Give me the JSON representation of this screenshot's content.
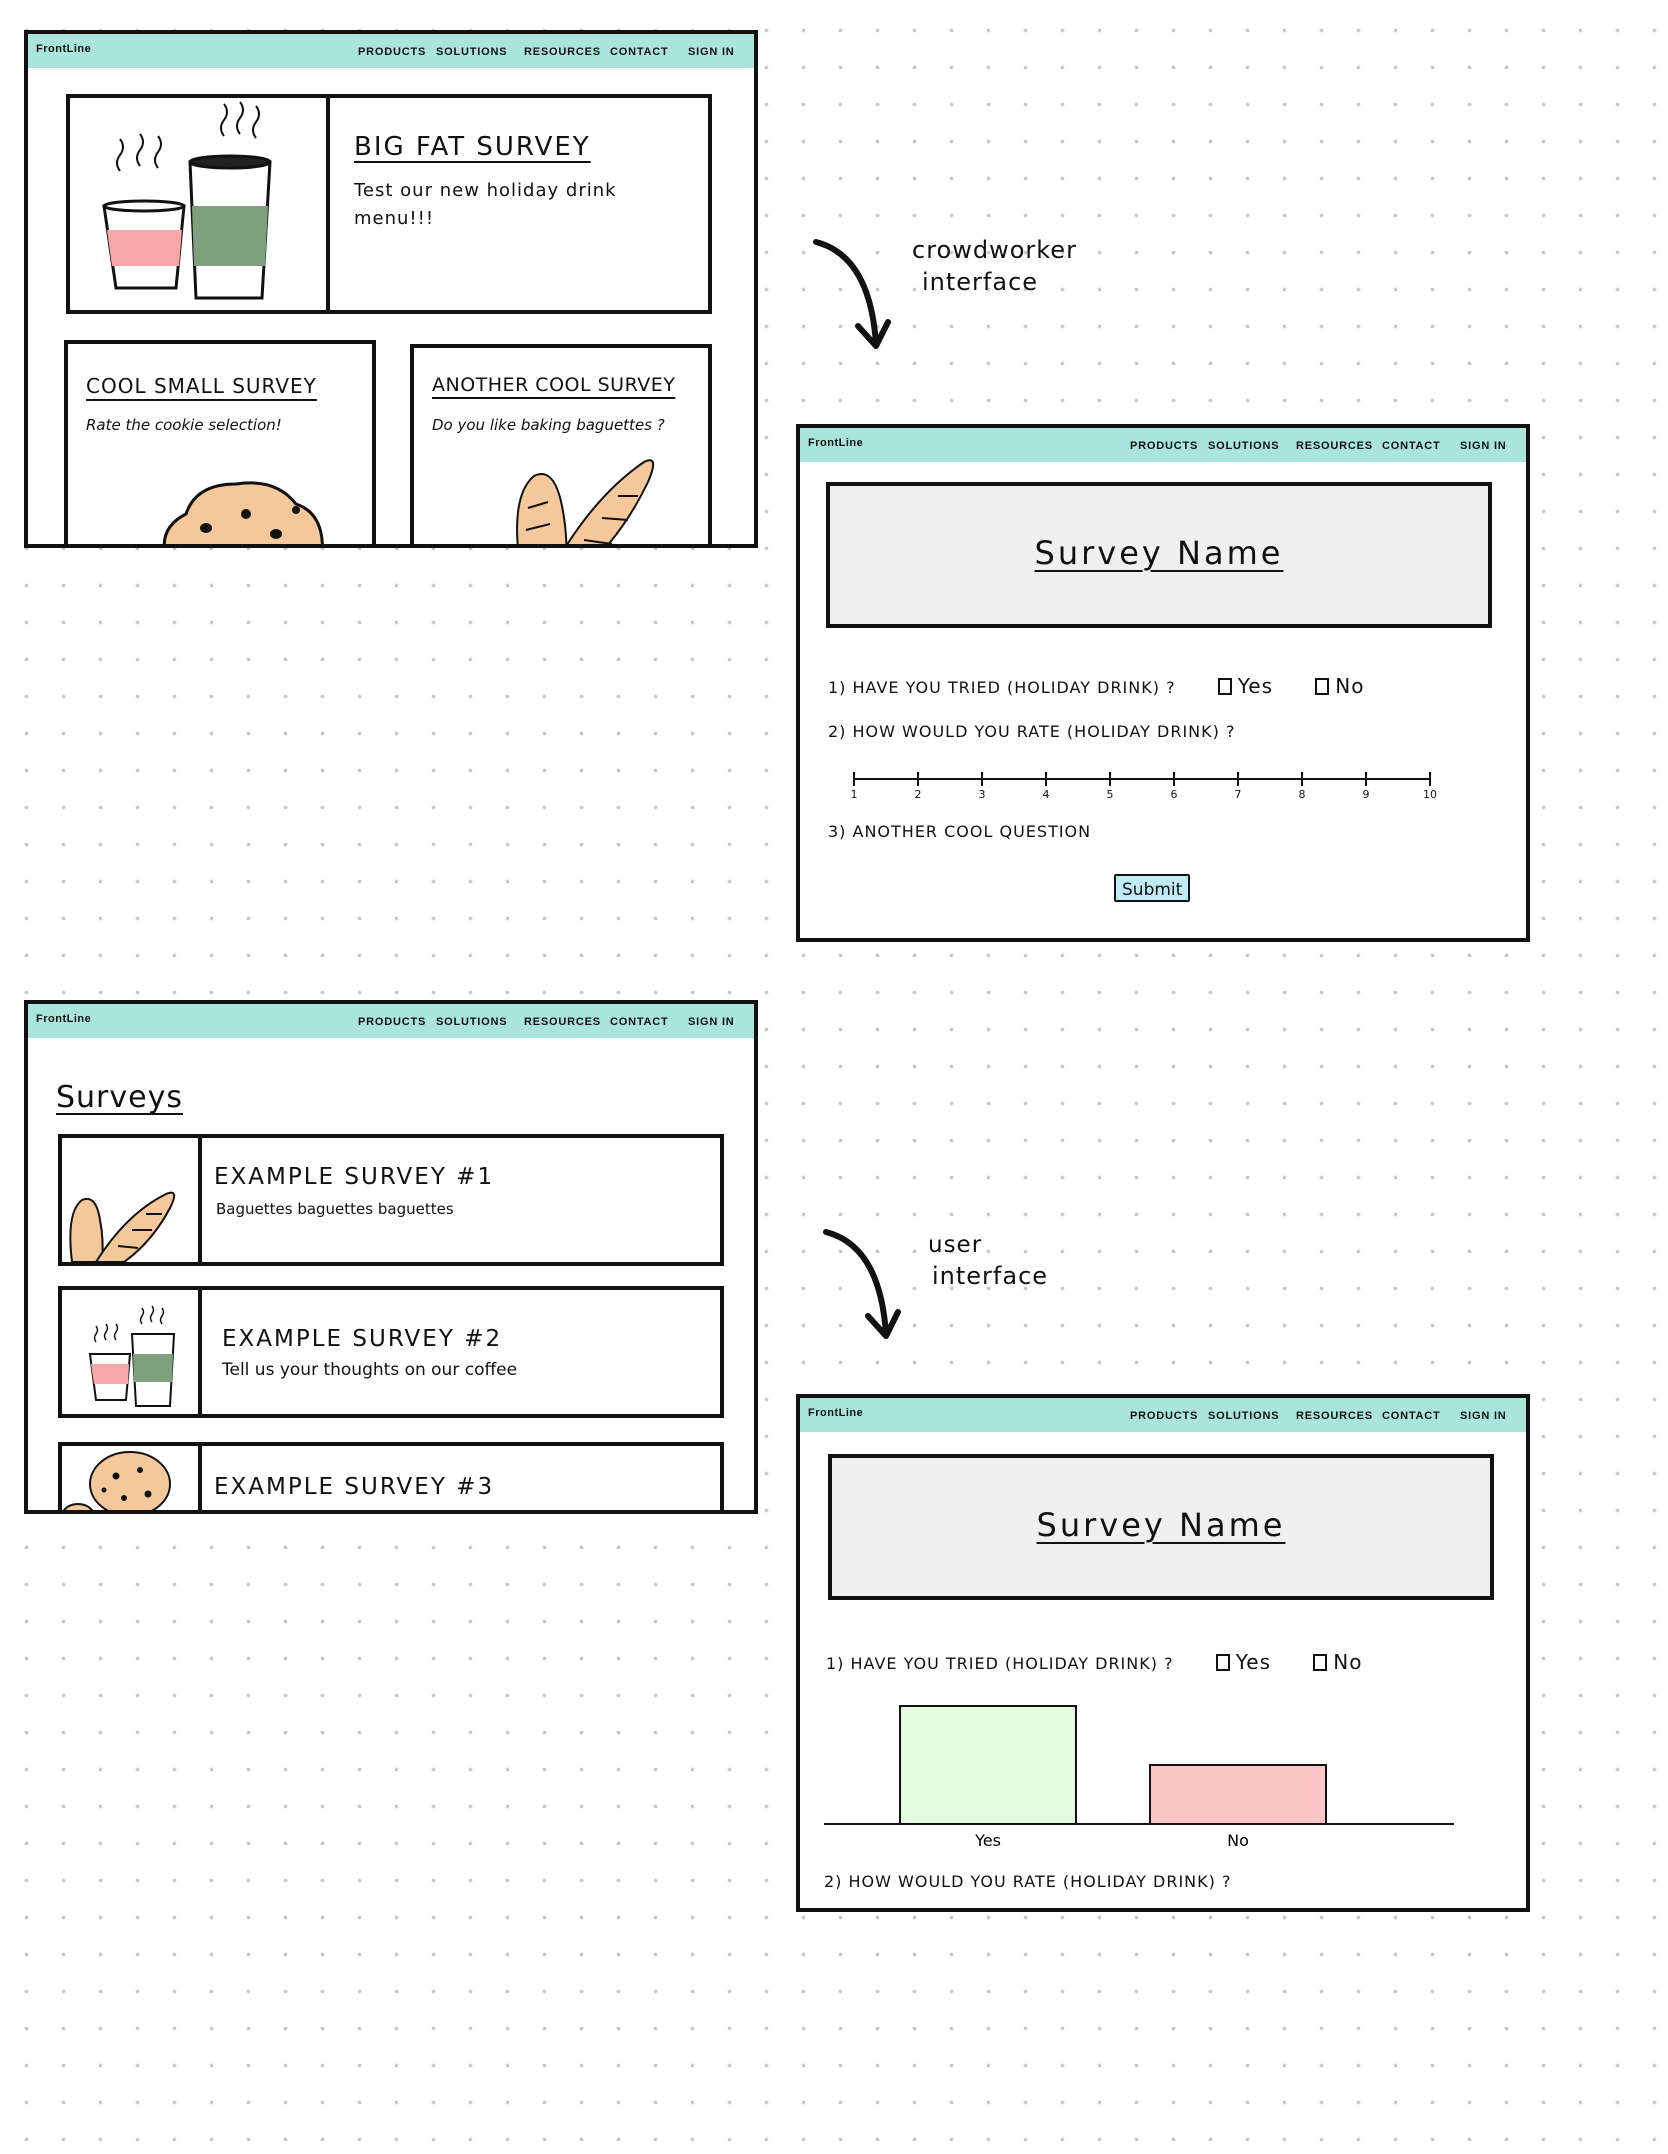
{
  "nav": {
    "brand": "FrontLine",
    "items": [
      "Products",
      "Solutions",
      "Resources",
      "Contact",
      "Sign in"
    ]
  },
  "home": {
    "featured": {
      "title": "BIG FAT SURVEY",
      "description_line1": "Test our new holiday drink",
      "description_line2": "menu!!!"
    },
    "card_small": {
      "title": "COOL SMALL SURVEY",
      "description": "Rate the cookie selection!"
    },
    "card_another": {
      "title": "ANOTHER COOL SURVEY",
      "description": "Do you like baking baguettes ?"
    }
  },
  "annotations": {
    "crowdworker_line1": "crowdworker",
    "crowdworker_line2": "interface",
    "user_line1": "user",
    "user_line2": "interface"
  },
  "crowd_form": {
    "survey_name": "Survey Name",
    "q1": "1) HAVE YOU TRIED (HOLIDAY DRINK) ?",
    "q1_yes": "Yes",
    "q1_no": "No",
    "q2": "2) HOW WOULD YOU RATE (HOLIDAY DRINK) ?",
    "scale": [
      "1",
      "2",
      "3",
      "4",
      "5",
      "6",
      "7",
      "8",
      "9",
      "10"
    ],
    "q3": "3) ANOTHER COOL QUESTION",
    "submit": "Submit"
  },
  "survey_list": {
    "heading": "Surveys",
    "items": [
      {
        "title": "EXAMPLE SURVEY #1",
        "description": "Baguettes baguettes baguettes",
        "icon": "baguette-icon"
      },
      {
        "title": "EXAMPLE SURVEY #2",
        "description": "Tell us your thoughts on our coffee",
        "icon": "coffee-cups-icon"
      },
      {
        "title": "EXAMPLE SURVEY #3",
        "description": "",
        "icon": "cookie-icon"
      }
    ]
  },
  "user_results": {
    "survey_name": "Survey Name",
    "q1": "1) HAVE YOU TRIED (HOLIDAY DRINK) ?",
    "q1_yes": "Yes",
    "q1_no": "No",
    "q2": "2) HOW WOULD YOU RATE (HOLIDAY DRINK) ?"
  },
  "chart_data": {
    "type": "bar",
    "categories": [
      "Yes",
      "No"
    ],
    "values": [
      2,
      1
    ],
    "colors": [
      "#e4fbdf",
      "#fdc6c6"
    ],
    "grid": false
  }
}
